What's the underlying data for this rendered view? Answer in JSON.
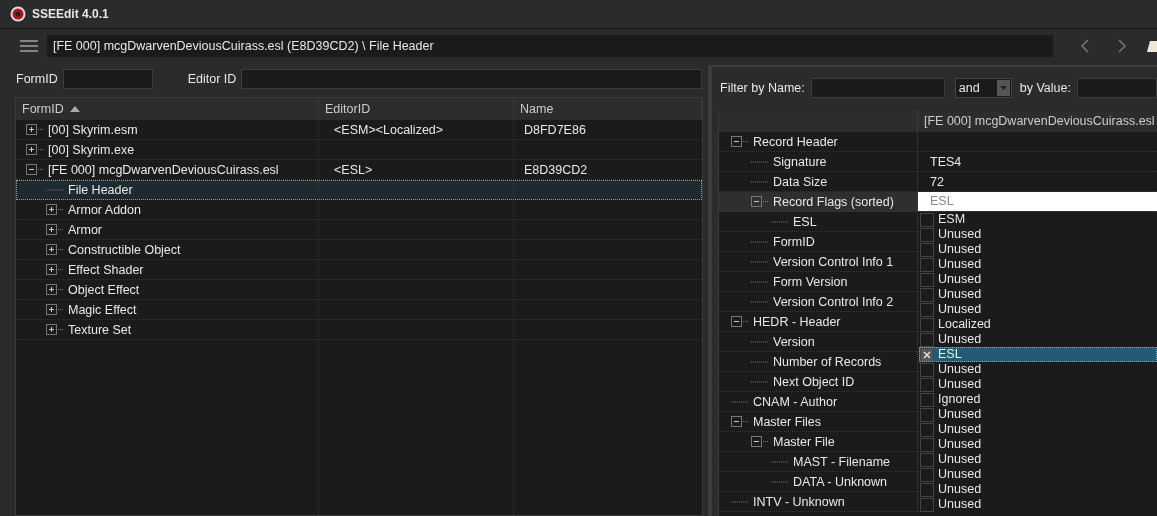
{
  "window": {
    "title": "SSEEdit 4.0.1"
  },
  "path_field": {
    "value": "[FE 000] mcgDwarvenDeviousCuirass.esl (E8D39CD2) \\ File Header"
  },
  "left_filter": {
    "formid_label": "FormID",
    "editorid_label": "Editor ID"
  },
  "records": {
    "columns": [
      "FormID",
      "EditorID",
      "Name"
    ],
    "rows": [
      {
        "formid": "[00] Skyrim.esm",
        "editorid": "<ESM><Localized>",
        "name": "D8FD7E86",
        "expanded": false,
        "selected": false
      },
      {
        "formid": "[00] Skyrim.exe",
        "expanded": false,
        "selected": false
      },
      {
        "formid": "[FE 000] mcgDwarvenDeviousCuirass.esl",
        "editorid": "<ESL>",
        "name": "E8D39CD2",
        "expanded": true,
        "selected": false,
        "children": [
          {
            "formid": "File Header",
            "selected": true
          },
          {
            "formid": "Armor Addon",
            "expanded": false,
            "selected": false
          },
          {
            "formid": "Armor",
            "expanded": false,
            "selected": false
          },
          {
            "formid": "Constructible Object",
            "expanded": false,
            "selected": false
          },
          {
            "formid": "Effect Shader",
            "expanded": false,
            "selected": false
          },
          {
            "formid": "Object Effect",
            "expanded": false,
            "selected": false
          },
          {
            "formid": "Magic Effect",
            "expanded": false,
            "selected": false
          },
          {
            "formid": "Texture Set",
            "expanded": false,
            "selected": false
          }
        ]
      }
    ]
  },
  "right_filter": {
    "name_label": "Filter by Name:",
    "operator": "and",
    "value_label": "by Value:"
  },
  "fields": {
    "column": "[FE 000] mcgDwarvenDeviousCuirass.esl",
    "rows": [
      {
        "label": "Record Header",
        "expanded": true,
        "selected": false,
        "children": [
          {
            "label": "Signature",
            "value": "TES4",
            "selected": false
          },
          {
            "label": "Data Size",
            "value": "72",
            "selected": false
          },
          {
            "label": "Record Flags (sorted)",
            "expanded": true,
            "selected": true,
            "edit_text": "ESL",
            "children": [
              {
                "label": "ESL",
                "selected": false
              }
            ]
          },
          {
            "label": "FormID",
            "selected": false
          },
          {
            "label": "Version Control Info 1",
            "selected": false
          },
          {
            "label": "Form Version",
            "selected": false
          },
          {
            "label": "Version Control Info 2",
            "selected": false
          }
        ]
      },
      {
        "label": "HEDR - Header",
        "expanded": true,
        "selected": false,
        "children": [
          {
            "label": "Version",
            "selected": false
          },
          {
            "label": "Number of Records",
            "selected": false
          },
          {
            "label": "Next Object ID",
            "selected": false
          }
        ]
      },
      {
        "label": "CNAM - Author",
        "selected": false
      },
      {
        "label": "Master Files",
        "expanded": true,
        "selected": false,
        "children": [
          {
            "label": "Master File",
            "expanded": true,
            "selected": false,
            "children": [
              {
                "label": "MAST - Filename",
                "selected": false
              },
              {
                "label": "DATA - Unknown",
                "selected": false
              }
            ]
          }
        ]
      },
      {
        "label": "INTV - Unknown",
        "selected": false
      }
    ]
  },
  "flags_list": [
    {
      "label": "ESM",
      "checked": false,
      "selected": false
    },
    {
      "label": "Unused",
      "checked": false,
      "selected": false
    },
    {
      "label": "Unused",
      "checked": false,
      "selected": false
    },
    {
      "label": "Unused",
      "checked": false,
      "selected": false
    },
    {
      "label": "Unused",
      "checked": false,
      "selected": false
    },
    {
      "label": "Unused",
      "checked": false,
      "selected": false
    },
    {
      "label": "Unused",
      "checked": false,
      "selected": false
    },
    {
      "label": "Localized",
      "checked": false,
      "selected": false
    },
    {
      "label": "Unused",
      "checked": false,
      "selected": false
    },
    {
      "label": "ESL",
      "checked": true,
      "selected": true
    },
    {
      "label": "Unused",
      "checked": false,
      "selected": false
    },
    {
      "label": "Unused",
      "checked": false,
      "selected": false
    },
    {
      "label": "Ignored",
      "checked": false,
      "selected": false
    },
    {
      "label": "Unused",
      "checked": false,
      "selected": false
    },
    {
      "label": "Unused",
      "checked": false,
      "selected": false
    },
    {
      "label": "Unused",
      "checked": false,
      "selected": false
    },
    {
      "label": "Unused",
      "checked": false,
      "selected": false
    },
    {
      "label": "Unused",
      "checked": false,
      "selected": false
    },
    {
      "label": "Unused",
      "checked": false,
      "selected": false
    },
    {
      "label": "Unused",
      "checked": false,
      "selected": false
    }
  ]
}
